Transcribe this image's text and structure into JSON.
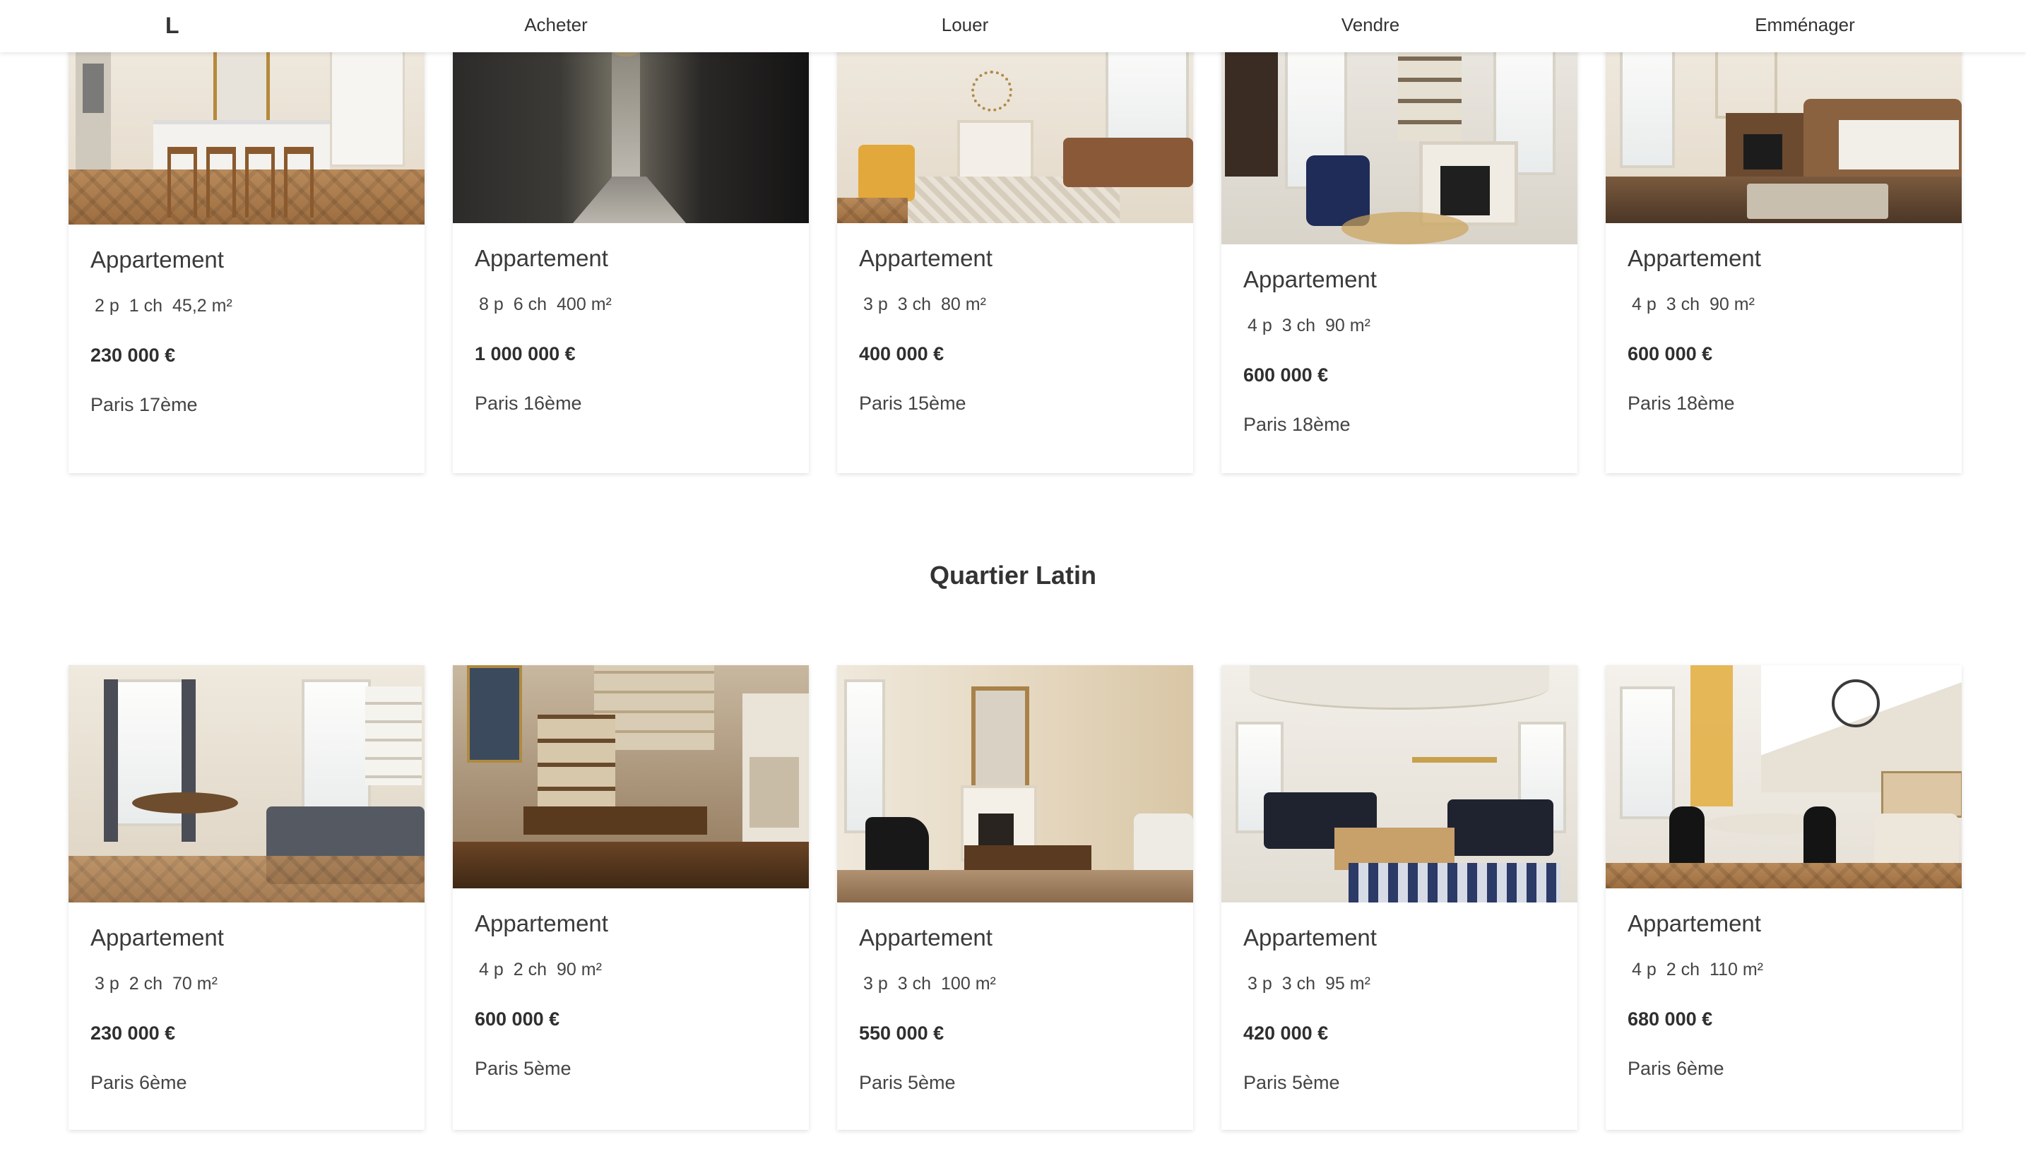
{
  "nav": {
    "logo": "L",
    "links": [
      "Acheter",
      "Louer",
      "Vendre",
      "Emménager"
    ]
  },
  "rows": [
    {
      "title": "",
      "cards": [
        {
          "type": "Appartement",
          "specs": [
            "2 p",
            "1 ch",
            "45,2 m²"
          ],
          "price": "230 000 €",
          "city": "Paris 17ème",
          "image": "kitchen-bar-stools-photo"
        },
        {
          "type": "Appartement",
          "specs": [
            "8 p",
            "6 ch",
            "400 m²"
          ],
          "price": "1 000 000 €",
          "city": "Paris 16ème",
          "image": "dark-hallway-photo"
        },
        {
          "type": "Appartement",
          "specs": [
            "3 p",
            "3 ch",
            "80 m²"
          ],
          "price": "400 000 €",
          "city": "Paris 15ème",
          "image": "living-room-yellow-chair-photo"
        },
        {
          "type": "Appartement",
          "specs": [
            "4 p",
            "3 ch",
            "90 m²"
          ],
          "price": "600 000 €",
          "city": "Paris 18ème",
          "image": "fireplace-bookshelf-photo"
        },
        {
          "type": "Appartement",
          "specs": [
            "4 p",
            "3 ch",
            "90 m²"
          ],
          "price": "600 000 €",
          "city": "Paris 18ème",
          "image": "bedroom-fireplace-photo"
        }
      ]
    },
    {
      "title": "Quartier Latin",
      "cards": [
        {
          "type": "Appartement",
          "specs": [
            "3 p",
            "2 ch",
            "70 m²"
          ],
          "price": "230 000 €",
          "city": "Paris 6ème",
          "image": "dining-living-room-photo"
        },
        {
          "type": "Appartement",
          "specs": [
            "4 p",
            "2 ch",
            "90 m²"
          ],
          "price": "600 000 €",
          "city": "Paris 5ème",
          "image": "stone-wall-dining-photo"
        },
        {
          "type": "Appartement",
          "specs": [
            "3 p",
            "3 ch",
            "100 m²"
          ],
          "price": "550 000 €",
          "city": "Paris 5ème",
          "image": "fireplace-mirror-lounge-photo"
        },
        {
          "type": "Appartement",
          "specs": [
            "3 p",
            "3 ch",
            "95 m²"
          ],
          "price": "420 000 €",
          "city": "Paris 5ème",
          "image": "blue-sofa-salon-photo"
        },
        {
          "type": "Appartement",
          "specs": [
            "4 p",
            "2 ch",
            "110 m²"
          ],
          "price": "680 000 €",
          "city": "Paris 6ème",
          "image": "attic-dining-photo"
        }
      ]
    }
  ]
}
